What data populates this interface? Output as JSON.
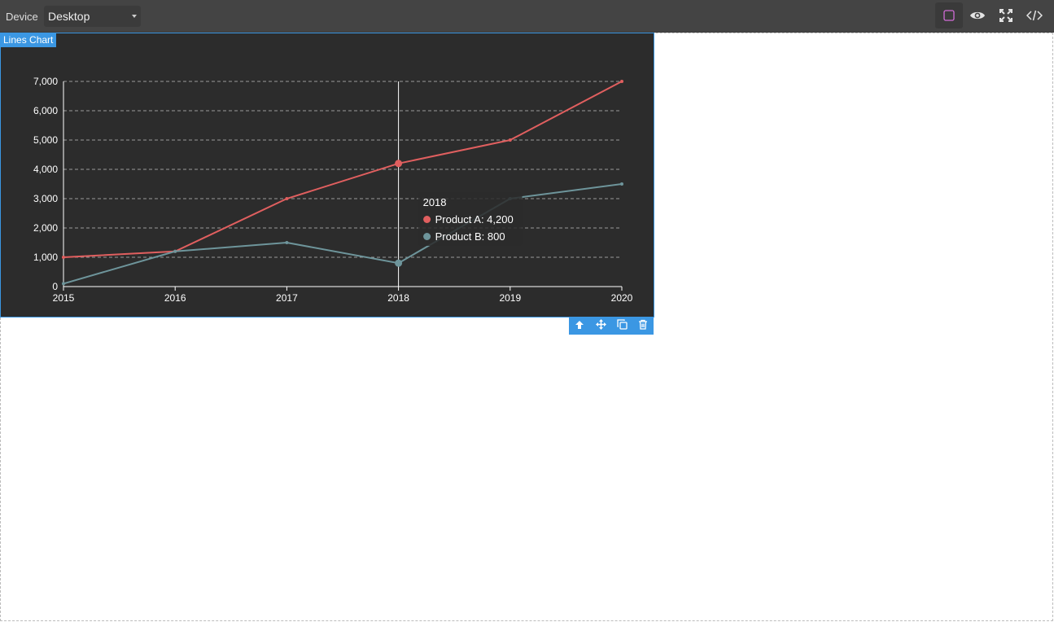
{
  "toolbar": {
    "device_label": "Device",
    "device_value": "Desktop",
    "buttons": [
      {
        "icon": "square-outline-icon",
        "color": "#d26cd8"
      },
      {
        "icon": "eye-icon"
      },
      {
        "icon": "fullscreen-icon"
      },
      {
        "icon": "code-icon"
      }
    ]
  },
  "block": {
    "badge": "Lines Chart",
    "actions": [
      "arrow-up-icon",
      "move-icon",
      "copy-icon",
      "trash-icon"
    ]
  },
  "chart_data": {
    "type": "line",
    "categories": [
      "2015",
      "2016",
      "2017",
      "2018",
      "2019",
      "2020"
    ],
    "series": [
      {
        "name": "Product A",
        "values": [
          1000,
          1200,
          3000,
          4200,
          5000,
          7000
        ],
        "color": "#e05f5f"
      },
      {
        "name": "Product B",
        "values": [
          100,
          1200,
          1500,
          800,
          3000,
          3500
        ],
        "color": "#6e959b"
      }
    ],
    "ylim": [
      0,
      7000
    ],
    "yticks": [
      "0",
      "1,000",
      "2,000",
      "3,000",
      "4,000",
      "5,000",
      "6,000",
      "7,000"
    ],
    "grid": true,
    "background": "#2c2c2c",
    "tooltip": {
      "title": "2018",
      "items": [
        "Product A: 4,200",
        "Product B: 800"
      ]
    }
  }
}
